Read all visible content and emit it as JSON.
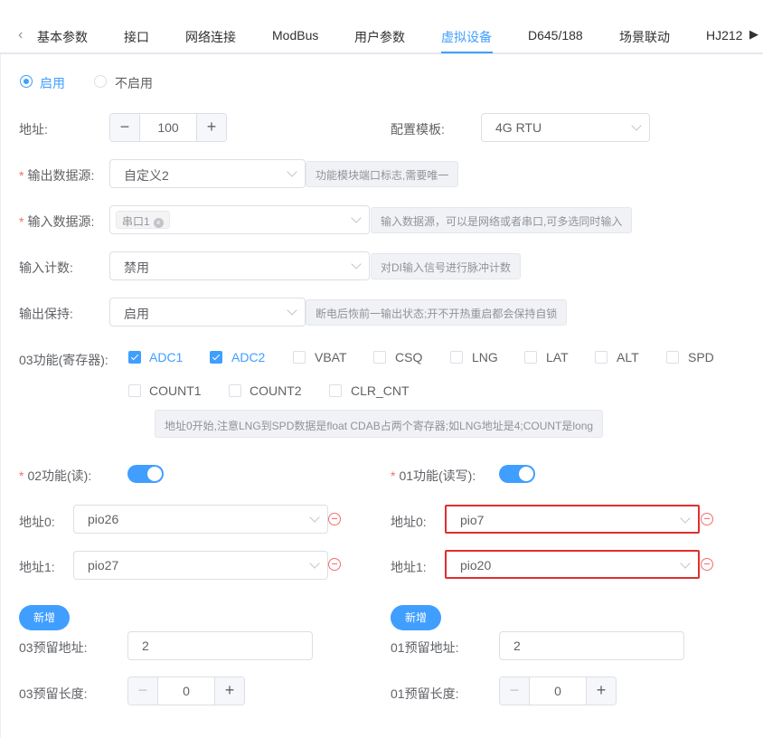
{
  "tabs": {
    "items": [
      "基本参数",
      "接口",
      "网络连接",
      "ModBus",
      "用户参数",
      "虚拟设备",
      "D645/188",
      "场景联动",
      "HJ212"
    ],
    "active": "虚拟设备",
    "prev_icon": "chevron-left-icon",
    "next_icon": "caret-right-icon"
  },
  "enable": {
    "on_label": "启用",
    "off_label": "不启用",
    "selected": "启用"
  },
  "address": {
    "label": "地址:",
    "value": "100",
    "minus": "−",
    "plus": "+"
  },
  "template": {
    "label": "配置模板:",
    "value": "4G RTU"
  },
  "output_source": {
    "label": "输出数据源:",
    "value": "自定义2",
    "hint": "功能模块端口标志,需要唯一"
  },
  "input_source": {
    "label": "输入数据源:",
    "tag": "串口1",
    "tag_close": "×",
    "hint": "输入数据源，可以是网络或者串口,可多选同时输入"
  },
  "input_count": {
    "label": "输入计数:",
    "value": "禁用",
    "hint": "对DI输入信号进行脉冲计数"
  },
  "output_hold": {
    "label": "输出保持:",
    "value": "启用",
    "hint": "断电后恢前一输出状态;开不开热重启都会保持自锁"
  },
  "func03": {
    "label": "03功能(寄存器):",
    "options": [
      {
        "label": "ADC1",
        "checked": true
      },
      {
        "label": "ADC2",
        "checked": true
      },
      {
        "label": "VBAT",
        "checked": false
      },
      {
        "label": "CSQ",
        "checked": false
      },
      {
        "label": "LNG",
        "checked": false
      },
      {
        "label": "LAT",
        "checked": false
      },
      {
        "label": "ALT",
        "checked": false
      },
      {
        "label": "SPD",
        "checked": false
      },
      {
        "label": "COUNT1",
        "checked": false
      },
      {
        "label": "COUNT2",
        "checked": false
      },
      {
        "label": "CLR_CNT",
        "checked": false
      }
    ],
    "hint": "地址0开始,注意LNG到SPD数据是float CDAB占两个寄存器;如LNG地址是4;COUNT是long"
  },
  "func02": {
    "label": "02功能(读):",
    "enabled": true,
    "rows": [
      {
        "label": "地址0:",
        "value": "pio26"
      },
      {
        "label": "地址1:",
        "value": "pio27"
      }
    ],
    "add_label": "新增",
    "reserved_addr": {
      "label": "03预留地址:",
      "value": "2"
    },
    "reserved_len": {
      "label": "03预留长度:",
      "value": "0"
    }
  },
  "func01": {
    "label": "01功能(读写):",
    "enabled": true,
    "rows": [
      {
        "label": "地址0:",
        "value": "pio7"
      },
      {
        "label": "地址1:",
        "value": "pio20"
      }
    ],
    "add_label": "新增",
    "reserved_addr": {
      "label": "01预留地址:",
      "value": "2"
    },
    "reserved_len": {
      "label": "01预留长度:",
      "value": "0"
    }
  },
  "colors": {
    "primary": "#409eff",
    "danger": "#f56c6c",
    "highlight": "#e02f2f"
  }
}
